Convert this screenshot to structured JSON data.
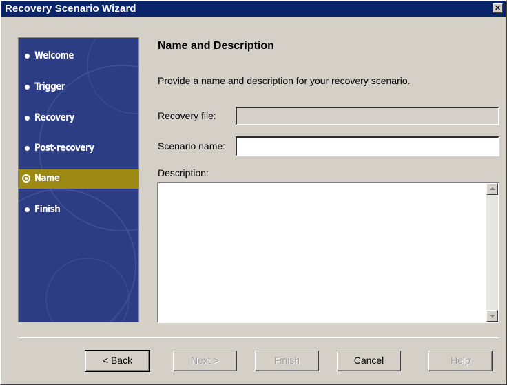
{
  "window": {
    "title": "Recovery Scenario Wizard",
    "close_glyph": "×"
  },
  "sidebar": {
    "items": [
      {
        "label": "Welcome",
        "active": false
      },
      {
        "label": "Trigger",
        "active": false
      },
      {
        "label": "Recovery",
        "active": false
      },
      {
        "label": "Post-recovery",
        "active": false
      },
      {
        "label": "Name",
        "active": true
      },
      {
        "label": "Finish",
        "active": false
      }
    ]
  },
  "page": {
    "heading": "Name and Description",
    "instructions": "Provide a name and description for your recovery scenario.",
    "recovery_file_label": "Recovery file:",
    "recovery_file_value": "",
    "scenario_name_label": "Scenario name:",
    "scenario_name_value": "",
    "description_label": "Description:",
    "description_value": ""
  },
  "buttons": {
    "back": "< Back",
    "next": "Next >",
    "finish": "Finish",
    "cancel": "Cancel",
    "help": "Help"
  },
  "colors": {
    "title_bar": "#0a246a",
    "sidebar_bg": "#2c3d84",
    "active_item": "#9c8a14",
    "dialog_bg": "#d4d0c8"
  }
}
